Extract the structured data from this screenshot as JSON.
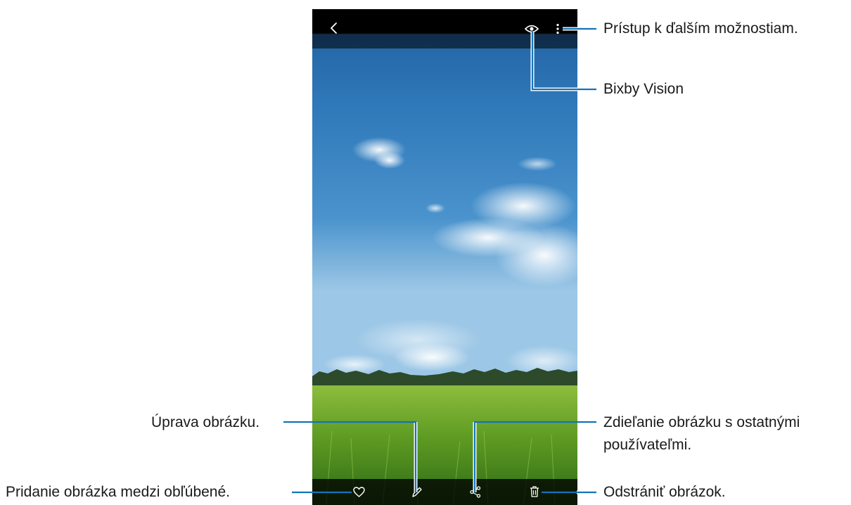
{
  "viewer": {
    "icons": {
      "back": "chevron-left-icon",
      "bixby": "eye-icon",
      "more": "more-vertical-icon",
      "favorite": "heart-icon",
      "edit": "pencil-icon",
      "share": "share-icon",
      "delete": "trash-icon"
    },
    "colors": {
      "callout_line": "#1473b8",
      "bar_background": "#000000",
      "icon": "#ffffff"
    }
  },
  "callouts": {
    "more_options": "Prístup k ďalším možnostiam.",
    "bixby_vision": "Bixby Vision",
    "edit_picture": "Úprava obrázku.",
    "share_picture_line1": "Zdieľanie obrázku s ostatnými",
    "share_picture_line2": "používateľmi.",
    "add_favorite": "Pridanie obrázka medzi obľúbené.",
    "delete_picture": "Odstrániť obrázok."
  }
}
